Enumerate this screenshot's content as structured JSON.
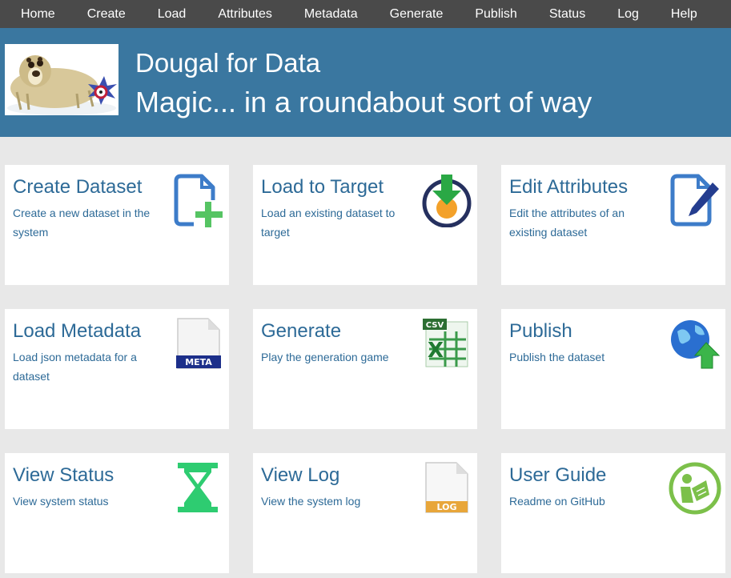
{
  "nav": {
    "items": [
      "Home",
      "Create",
      "Load",
      "Attributes",
      "Metadata",
      "Generate",
      "Publish",
      "Status",
      "Log",
      "Help"
    ]
  },
  "banner": {
    "title": "Dougal for Data",
    "tagline": "Magic... in a roundabout sort of way"
  },
  "tiles": [
    {
      "title": "Create Dataset",
      "description": "Create a new dataset in the system",
      "icon": "new-file-plus-icon"
    },
    {
      "title": "Load to Target",
      "description": "Load an existing dataset to target",
      "icon": "download-target-icon"
    },
    {
      "title": "Edit Attributes",
      "description": "Edit the attributes of an existing dataset",
      "icon": "edit-document-icon"
    },
    {
      "title": "Load Metadata",
      "description": "Load json metadata for a dataset",
      "icon": "meta-file-icon",
      "icon_label": "META"
    },
    {
      "title": "Generate",
      "description": "Play the generation game",
      "icon": "csv-spreadsheet-icon",
      "icon_label": "CSV"
    },
    {
      "title": "Publish",
      "description": "Publish the dataset",
      "icon": "globe-upload-icon"
    },
    {
      "title": "View Status",
      "description": "View system status",
      "icon": "hourglass-icon"
    },
    {
      "title": "View Log",
      "description": "View the system log",
      "icon": "log-file-icon",
      "icon_label": "LOG"
    },
    {
      "title": "User Guide",
      "description": "Readme on GitHub",
      "icon": "reading-person-icon"
    }
  ],
  "colors": {
    "nav_bg": "#4a4a4a",
    "banner_bg": "#3a77a0",
    "page_bg": "#e8e8e8",
    "tile_text": "#2d6a97"
  }
}
